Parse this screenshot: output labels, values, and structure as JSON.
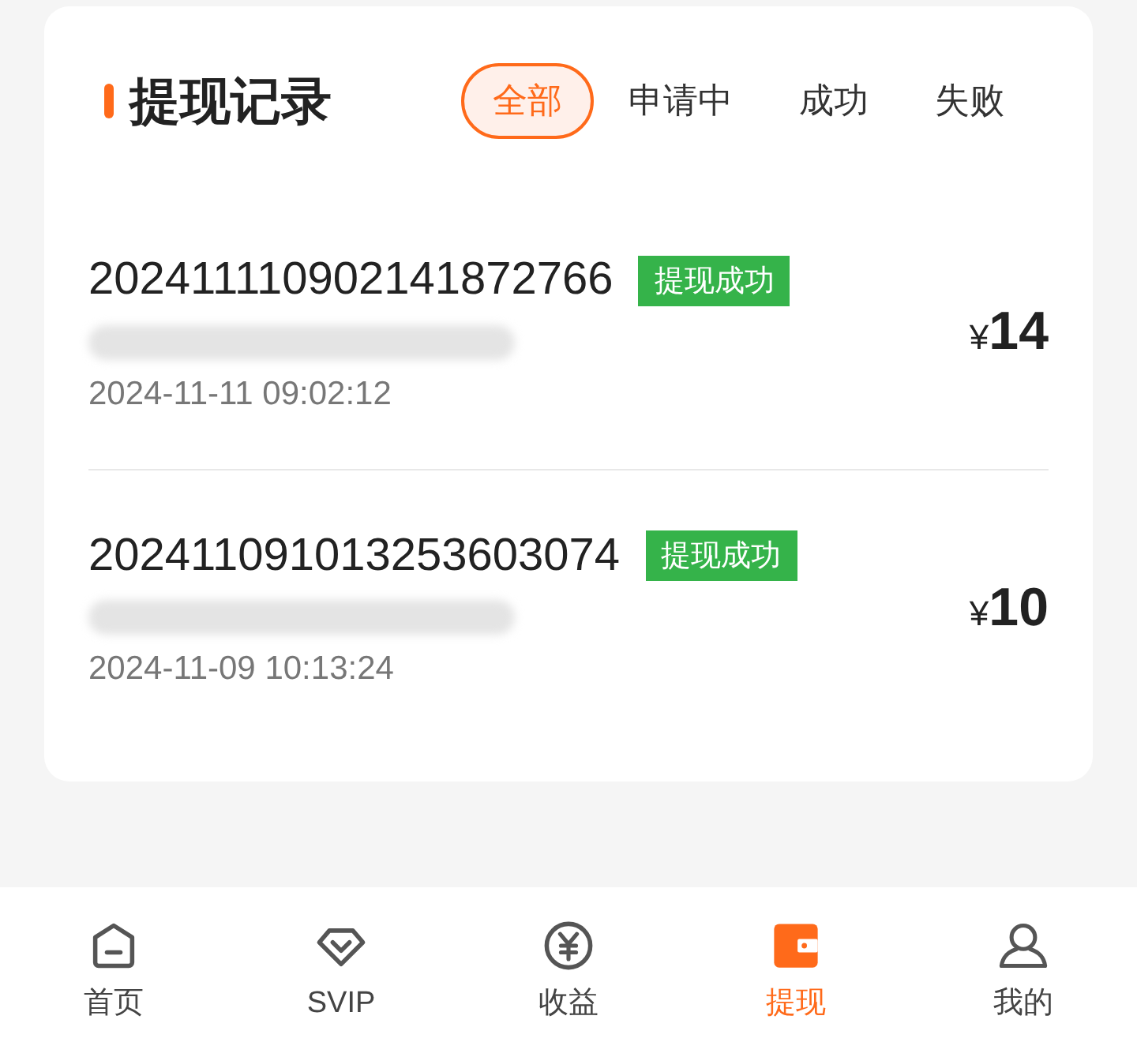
{
  "header": {
    "title": "提现记录"
  },
  "filters": [
    {
      "label": "全部",
      "selected": true
    },
    {
      "label": "申请中",
      "selected": false
    },
    {
      "label": "成功",
      "selected": false
    },
    {
      "label": "失败",
      "selected": false
    }
  ],
  "records": [
    {
      "order_no": "202411110902141872766",
      "status": "提现成功",
      "time": "2024-11-11 09:02:12",
      "currency": "¥",
      "amount": "14"
    },
    {
      "order_no": "202411091013253603074",
      "status": "提现成功",
      "time": "2024-11-09 10:13:24",
      "currency": "¥",
      "amount": "10"
    }
  ],
  "nav": [
    {
      "label": "首页",
      "kind": "home",
      "selected": false
    },
    {
      "label": "SVIP",
      "kind": "diamond",
      "selected": false
    },
    {
      "label": "收益",
      "kind": "yen",
      "selected": false
    },
    {
      "label": "提现",
      "kind": "wallet",
      "selected": true
    },
    {
      "label": "我的",
      "kind": "user",
      "selected": false
    }
  ]
}
